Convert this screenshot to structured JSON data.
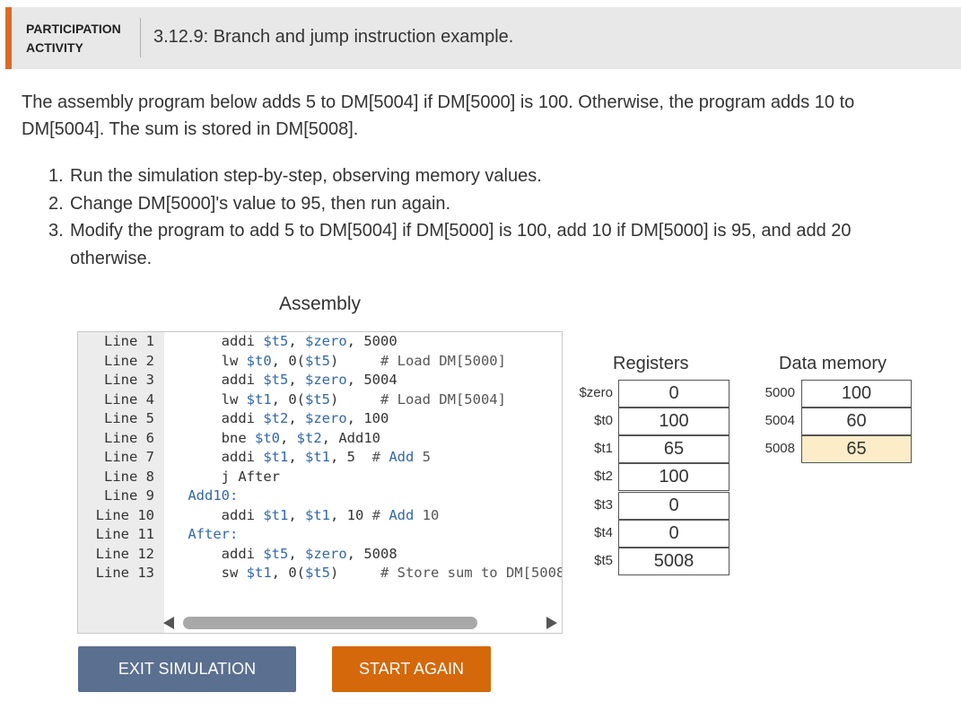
{
  "activity": {
    "label_line1": "PARTICIPATION",
    "label_line2": "ACTIVITY",
    "title": "3.12.9: Branch and jump instruction example."
  },
  "intro": "The assembly program below adds 5 to DM[5004] if DM[5000] is 100. Otherwise, the program adds 10 to DM[5004]. The sum is stored in DM[5008].",
  "steps": [
    {
      "num": "1.",
      "text": "Run the simulation step-by-step, observing memory values."
    },
    {
      "num": "2.",
      "text": "Change DM[5000]'s value to 95, then run again."
    },
    {
      "num": "3.",
      "text": "Modify the program to add 5 to DM[5004] if DM[5000] is 100, add 10 if DM[5000] is 95, and add 20 otherwise."
    }
  ],
  "assembly": {
    "title": "Assembly",
    "lines": [
      {
        "num": "Line 1",
        "parts": [
          [
            "",
            "        addi "
          ],
          [
            "reg",
            "$t5"
          ],
          [
            "",
            ", "
          ],
          [
            "reg",
            "$zero"
          ],
          [
            "",
            ", 5000"
          ]
        ]
      },
      {
        "num": "Line 2",
        "parts": [
          [
            "",
            "        lw "
          ],
          [
            "reg",
            "$t0"
          ],
          [
            "",
            ", 0("
          ],
          [
            "reg",
            "$t5"
          ],
          [
            "",
            ")     "
          ],
          [
            "cmt",
            "# Load DM[5000]"
          ]
        ]
      },
      {
        "num": "Line 3",
        "parts": [
          [
            "",
            "        addi "
          ],
          [
            "reg",
            "$t5"
          ],
          [
            "",
            ", "
          ],
          [
            "reg",
            "$zero"
          ],
          [
            "",
            ", 5004"
          ]
        ]
      },
      {
        "num": "Line 4",
        "parts": [
          [
            "",
            "        lw "
          ],
          [
            "reg",
            "$t1"
          ],
          [
            "",
            ", 0("
          ],
          [
            "reg",
            "$t5"
          ],
          [
            "",
            ")     "
          ],
          [
            "cmt",
            "# Load DM[5004]"
          ]
        ]
      },
      {
        "num": "Line 5",
        "parts": [
          [
            "",
            "        addi "
          ],
          [
            "reg",
            "$t2"
          ],
          [
            "",
            ", "
          ],
          [
            "reg",
            "$zero"
          ],
          [
            "",
            ", 100"
          ]
        ]
      },
      {
        "num": "Line 6",
        "parts": [
          [
            "",
            "        bne "
          ],
          [
            "reg",
            "$t0"
          ],
          [
            "",
            ", "
          ],
          [
            "reg",
            "$t2"
          ],
          [
            "",
            ", Add10"
          ]
        ]
      },
      {
        "num": "Line 7",
        "parts": [
          [
            "",
            "        addi "
          ],
          [
            "reg",
            "$t1"
          ],
          [
            "",
            ", "
          ],
          [
            "reg",
            "$t1"
          ],
          [
            "",
            ", 5  "
          ],
          [
            "cmt",
            "# "
          ],
          [
            "kw",
            "Add"
          ],
          [
            "cmt",
            " 5"
          ]
        ]
      },
      {
        "num": "Line 8",
        "parts": [
          [
            "",
            "        j After"
          ]
        ]
      },
      {
        "num": "Line 9",
        "parts": [
          [
            "",
            "    "
          ],
          [
            "lbl",
            "Add10:"
          ]
        ]
      },
      {
        "num": "Line 10",
        "parts": [
          [
            "",
            "        addi "
          ],
          [
            "reg",
            "$t1"
          ],
          [
            "",
            ", "
          ],
          [
            "reg",
            "$t1"
          ],
          [
            "",
            ", 10 "
          ],
          [
            "cmt",
            "# "
          ],
          [
            "kw",
            "Add"
          ],
          [
            "cmt",
            " 10"
          ]
        ]
      },
      {
        "num": "Line 11",
        "parts": [
          [
            "",
            "    "
          ],
          [
            "lbl",
            "After:"
          ]
        ]
      },
      {
        "num": "Line 12",
        "parts": [
          [
            "",
            "        addi "
          ],
          [
            "reg",
            "$t5"
          ],
          [
            "",
            ", "
          ],
          [
            "reg",
            "$zero"
          ],
          [
            "",
            ", 5008"
          ]
        ]
      },
      {
        "num": "Line 13",
        "parts": [
          [
            "",
            "        sw "
          ],
          [
            "reg",
            "$t1"
          ],
          [
            "",
            ", 0("
          ],
          [
            "reg",
            "$t5"
          ],
          [
            "",
            ")     "
          ],
          [
            "cmt",
            "# Store sum to DM[5008"
          ]
        ]
      }
    ]
  },
  "buttons": {
    "exit": "EXIT SIMULATION",
    "start_again": "START AGAIN"
  },
  "registers": {
    "title": "Registers",
    "items": [
      {
        "name": "$zero",
        "value": "0"
      },
      {
        "name": "$t0",
        "value": "100"
      },
      {
        "name": "$t1",
        "value": "65"
      },
      {
        "name": "$t2",
        "value": "100"
      },
      {
        "name": "$t3",
        "value": "0"
      },
      {
        "name": "$t4",
        "value": "0"
      },
      {
        "name": "$t5",
        "value": "5008"
      }
    ]
  },
  "data_memory": {
    "title": "Data memory",
    "items": [
      {
        "addr": "5000",
        "value": "100",
        "highlight": false
      },
      {
        "addr": "5004",
        "value": "60",
        "highlight": false
      },
      {
        "addr": "5008",
        "value": "65",
        "highlight": true
      }
    ]
  },
  "colors": {
    "accent_orange": "#d4680a",
    "exit_button": "#5b6f90",
    "register_blue": "#3068a8",
    "highlight_cell": "#fdecc8"
  }
}
